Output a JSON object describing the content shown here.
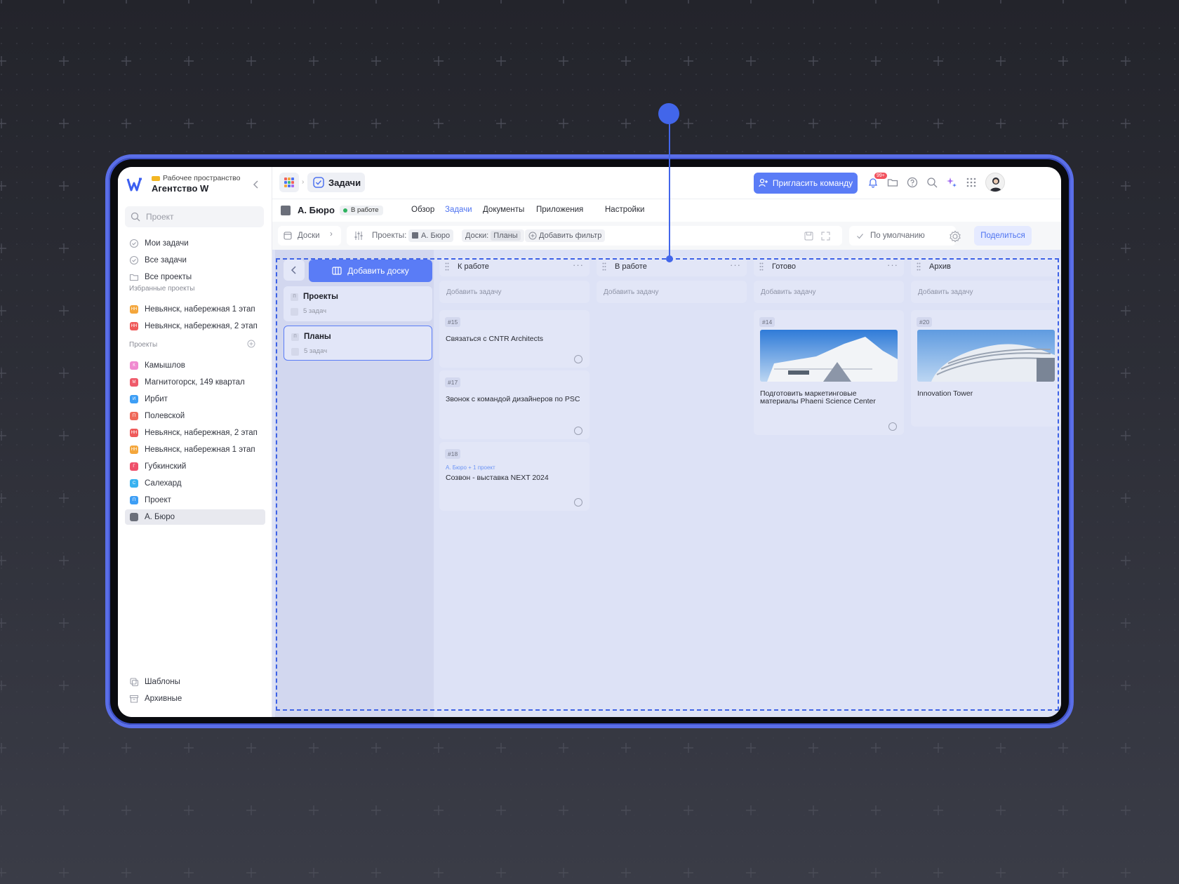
{
  "workspace": {
    "tag": "Рабочее пространство",
    "name": "Агентство W"
  },
  "sidebar": {
    "search_placeholder": "Проект",
    "nav": [
      {
        "label": "Мои задачи",
        "icon": "check-circle-icon"
      },
      {
        "label": "Все задачи",
        "icon": "check-circle-icon"
      },
      {
        "label": "Все проекты",
        "icon": "folder-icon"
      }
    ],
    "favorites_header": "Избранные проекты",
    "favorites": [
      {
        "label": "Невьянск, набережная 1 этап",
        "color": "#f4a63b",
        "abbr": "НН"
      },
      {
        "label": "Невьянск, набережная, 2 этап",
        "color": "#ef5a5a",
        "abbr": "НН"
      }
    ],
    "projects_header": "Проекты",
    "projects": [
      {
        "label": "Камышлов",
        "color": "#f08ad0",
        "abbr": "К"
      },
      {
        "label": "Магнитогорск, 149 квартал",
        "color": "#ef5a6a",
        "abbr": "М"
      },
      {
        "label": "Ирбит",
        "color": "#3d9ef5",
        "abbr": "И"
      },
      {
        "label": "Полевской",
        "color": "#ef6a5a",
        "abbr": "П"
      },
      {
        "label": "Невьянск, набережная, 2 этап",
        "color": "#ef5a5a",
        "abbr": "НН"
      },
      {
        "label": "Невьянск, набережная 1 этап",
        "color": "#f4a63b",
        "abbr": "НН"
      },
      {
        "label": "Губкинский",
        "color": "#ef4f6a",
        "abbr": "Г"
      },
      {
        "label": "Салехард",
        "color": "#38b2f0",
        "abbr": "С"
      },
      {
        "label": "Проект",
        "color": "#3d9ef5",
        "abbr": "П"
      },
      {
        "label": "А. Бюро",
        "color": "#6b6f7a",
        "abbr": ""
      }
    ],
    "bottom": [
      {
        "label": "Шаблоны",
        "icon": "templates-icon"
      },
      {
        "label": "Архивные",
        "icon": "archive-icon"
      }
    ]
  },
  "topbar": {
    "section": "Задачи",
    "invite_label": "Пригласить команду",
    "notifications_badge": "99+"
  },
  "project": {
    "name": "А. Бюро",
    "status": "В работе",
    "tabs": [
      "Обзор",
      "Задачи",
      "Документы",
      "Приложения",
      "Настройки"
    ],
    "active_tab": "Задачи"
  },
  "filters": {
    "view": "Доски",
    "projects_label": "Проекты:",
    "projects_value": "А. Бюро",
    "boards_label": "Доски:",
    "boards_value": "Планы",
    "add_filter": "Добавить фильтр",
    "sort": "По умолчанию",
    "share": "Поделиться"
  },
  "boards": {
    "add_label": "Добавить доску",
    "items": [
      {
        "title": "Проекты",
        "count": "5 задач",
        "badge": "П"
      },
      {
        "title": "Планы",
        "count": "5 задач",
        "badge": "П"
      }
    ]
  },
  "add_task_label": "Добавить задачу",
  "columns": [
    {
      "name": "К работе",
      "cards": [
        {
          "num": "#15",
          "title": "Связаться с CNTR Architects"
        },
        {
          "num": "#17",
          "title": "Звонок с командой дизайнеров по PSC"
        },
        {
          "num": "#18",
          "meta": "А. Бюро + 1 проект",
          "title": "Созвон - выставка NEXT 2024"
        }
      ]
    },
    {
      "name": "В работе",
      "cards": []
    },
    {
      "name": "Готово",
      "cards": [
        {
          "num": "#14",
          "title": "Подготовить маркетинговые материалы Phaeni Science Center"
        }
      ]
    },
    {
      "name": "Архив",
      "cards": [
        {
          "num": "#20",
          "title": "Innovation Tower"
        }
      ]
    }
  ],
  "colors": {
    "accent": "#5a7cf6",
    "highlight": "#4266ea",
    "board_bg": "#dde2f6"
  }
}
